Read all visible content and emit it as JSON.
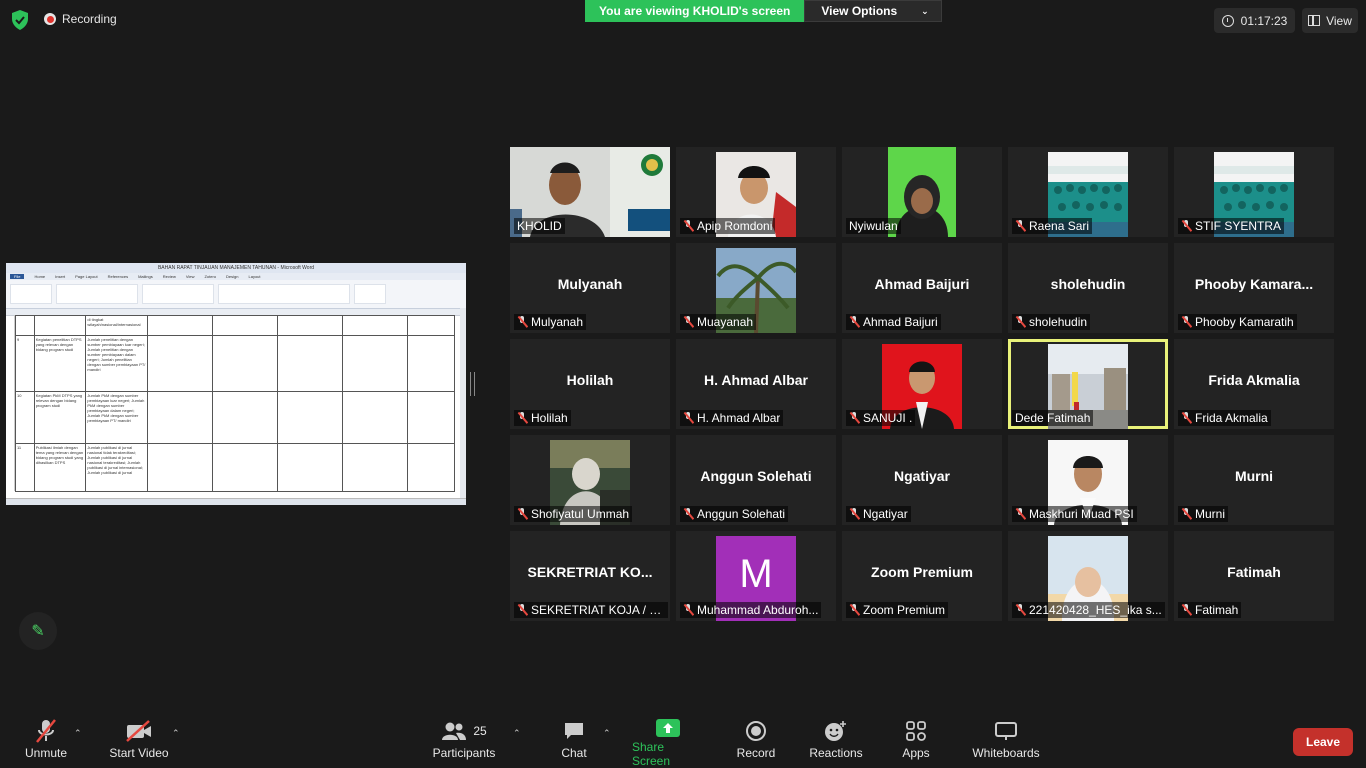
{
  "topbar": {
    "recording_label": "Recording",
    "viewing_banner": "You are viewing KHOLID's screen",
    "view_options_label": "View Options",
    "timer": "01:17:23",
    "view_label": "View"
  },
  "shared_doc": {
    "window_title": "BAHAN RAPAT TINJAUAN MANAJEMEN TAHUNAN - Microsoft Word",
    "tabs": [
      "File",
      "Home",
      "Insert",
      "Page Layout",
      "References",
      "Mailings",
      "Review",
      "View",
      "Zotero",
      "Design",
      "Layout"
    ],
    "rows": [
      {
        "no": "",
        "kegiatan": "",
        "indikator": "di tingkat wilayah/nasional/internasional"
      },
      {
        "no": "9",
        "kegiatan": "Kegiatan penelitian DTPS yang relevan dengan bidang program studi",
        "indikator": "Jumlah penelitian dengan sumber pembiayaan luar negeri; Jumlah penelitian dengan sumber pembiayaan dalam negeri; Jumlah penelitian dengan sumber pembiayaan PT/ mandiri"
      },
      {
        "no": "10",
        "kegiatan": "Kegiatan PkM DTPS yang relevan dengan bidang program studi",
        "indikator": "Jumlah PkM dengan sumber pembiayaan luar negeri; Jumlah PkM dengan sumber pembiayaan dalam negeri; Jumlah PkM dengan sumber pembiayaan PT/ mandiri"
      },
      {
        "no": "11",
        "kegiatan": "Publikasi ilmiah dengan tema yang relevan dengan bidang program studi yang dihasilkan DTPS",
        "indikator": "Jumlah publikasi di jurnal nasional tidak terakreditasi; Jumlah publikasi di jurnal nasional terakreditasi; Jumlah publikasi di jurnal internasional; Jumlah publikasi di jurnal"
      }
    ]
  },
  "participants": [
    {
      "name": "KHOLID",
      "display": "",
      "muted": false,
      "video": "kholid"
    },
    {
      "name": "Apip Romdoni",
      "display": "",
      "muted": true,
      "video": "apip"
    },
    {
      "name": "Nyiwulan",
      "display": "",
      "muted": false,
      "video": "nyiwulan"
    },
    {
      "name": "Raena Sari",
      "display": "",
      "muted": true,
      "video": "launching"
    },
    {
      "name": "STIF SYENTRA",
      "display": "",
      "muted": true,
      "video": "launching"
    },
    {
      "name": "Mulyanah",
      "display": "Mulyanah",
      "muted": true,
      "video": ""
    },
    {
      "name": "Muayanah",
      "display": "",
      "muted": true,
      "video": "palm"
    },
    {
      "name": "Ahmad Baijuri",
      "display": "Ahmad Baijuri",
      "muted": true,
      "video": ""
    },
    {
      "name": "sholehudin",
      "display": "sholehudin",
      "muted": true,
      "video": ""
    },
    {
      "name": "Phooby Kamaratih",
      "display": "Phooby  Kamara...",
      "muted": true,
      "video": ""
    },
    {
      "name": "Holilah",
      "display": "Holilah",
      "muted": true,
      "video": ""
    },
    {
      "name": "H. Ahmad Albar",
      "display": "H. Ahmad Albar",
      "muted": true,
      "video": ""
    },
    {
      "name": "SANUJI .",
      "display": "",
      "muted": true,
      "video": "sanuji"
    },
    {
      "name": "Dede Fatimah",
      "display": "",
      "muted": false,
      "video": "dede",
      "active": true
    },
    {
      "name": "Frida Akmalia",
      "display": "Frida Akmalia",
      "muted": true,
      "video": ""
    },
    {
      "name": "Shofiyatul Ummah",
      "display": "",
      "muted": true,
      "video": "shofi"
    },
    {
      "name": "Anggun Solehati",
      "display": "Anggun Solehati",
      "muted": true,
      "video": ""
    },
    {
      "name": "Ngatiyar",
      "display": "Ngatiyar",
      "muted": true,
      "video": ""
    },
    {
      "name": "Maskhuri Muad PSI",
      "display": "",
      "muted": true,
      "video": "maskhuri"
    },
    {
      "name": "Murni",
      "display": "Murni",
      "muted": true,
      "video": ""
    },
    {
      "name": "SEKRETRIAT KOJA / U...",
      "display": "SEKRETRIAT  KO...",
      "muted": true,
      "video": ""
    },
    {
      "name": "Muhammad Abduroh...",
      "display": "",
      "muted": true,
      "video": "avatar-m",
      "avatar_letter": "M"
    },
    {
      "name": "Zoom Premium",
      "display": "Zoom Premium",
      "muted": true,
      "video": ""
    },
    {
      "name": "221420428_HES_ika s...",
      "display": "",
      "muted": true,
      "video": "ika"
    },
    {
      "name": "Fatimah",
      "display": "Fatimah",
      "muted": true,
      "video": ""
    }
  ],
  "footer": {
    "unmute": "Unmute",
    "start_video": "Start Video",
    "participants": "Participants",
    "participants_count": "25",
    "chat": "Chat",
    "share_screen": "Share Screen",
    "record": "Record",
    "reactions": "Reactions",
    "apps": "Apps",
    "whiteboards": "Whiteboards",
    "leave": "Leave"
  },
  "colors": {
    "accent_green": "#2dc25a",
    "leave_red": "#c4312b",
    "active_speaker": "#e9f27a",
    "avatar_purple": "#a22fb8"
  }
}
